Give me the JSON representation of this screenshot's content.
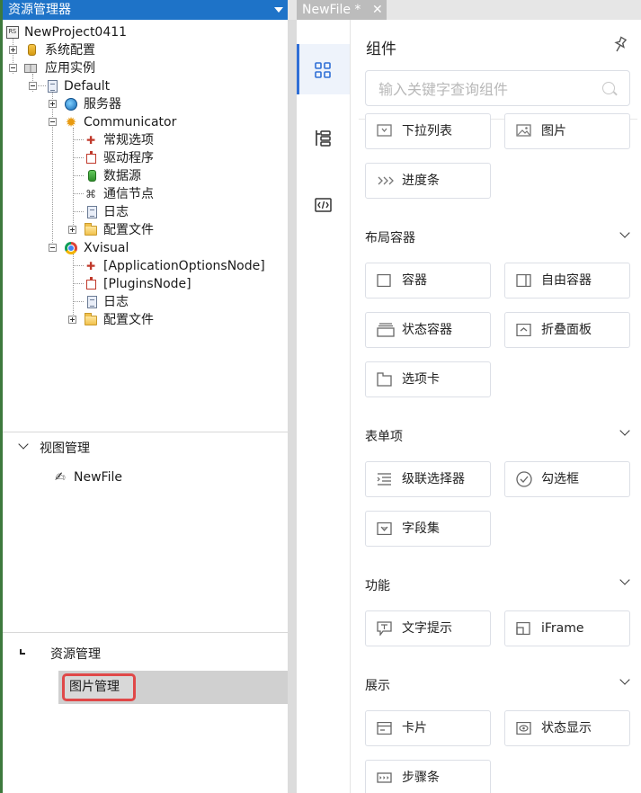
{
  "explorer": {
    "title": "资源管理器",
    "tree": {
      "project": "NewProject0411",
      "sys_config": "系统配置",
      "app_instance": "应用实例",
      "default": "Default",
      "server": "服务器",
      "communicator": "Communicator",
      "comm_general": "常规选项",
      "comm_driver": "驱动程序",
      "comm_datasource": "数据源",
      "comm_node": "通信节点",
      "comm_log": "日志",
      "comm_config": "配置文件",
      "xvisual": "Xvisual",
      "xv_appoptions": "[ApplicationOptionsNode]",
      "xv_plugins": "[PluginsNode]",
      "xv_log": "日志",
      "xv_config": "配置文件"
    },
    "view_mgmt": {
      "title": "视图管理",
      "file": "NewFile"
    },
    "res_mgmt": {
      "title": "资源管理",
      "image_mgmt": "图片管理"
    }
  },
  "tab": {
    "label": "NewFile *",
    "close": "✕"
  },
  "panel": {
    "title": "组件",
    "search_placeholder": "输入关键字查询组件",
    "top_items": {
      "dropdown": "下拉列表",
      "image": "图片",
      "progress": "进度条"
    },
    "groups": {
      "layout": {
        "title": "布局容器",
        "items": [
          "容器",
          "自由容器",
          "状态容器",
          "折叠面板",
          "选项卡"
        ]
      },
      "form": {
        "title": "表单项",
        "items": [
          "级联选择器",
          "勾选框",
          "字段集"
        ]
      },
      "func": {
        "title": "功能",
        "items": [
          "文字提示",
          "iFrame"
        ]
      },
      "display": {
        "title": "展示",
        "items": [
          "卡片",
          "状态显示",
          "步骤条"
        ]
      }
    }
  },
  "colors": {
    "title_bar": "#1e73c8",
    "accent": "#2f6fd6",
    "highlight_border": "#e04848"
  }
}
